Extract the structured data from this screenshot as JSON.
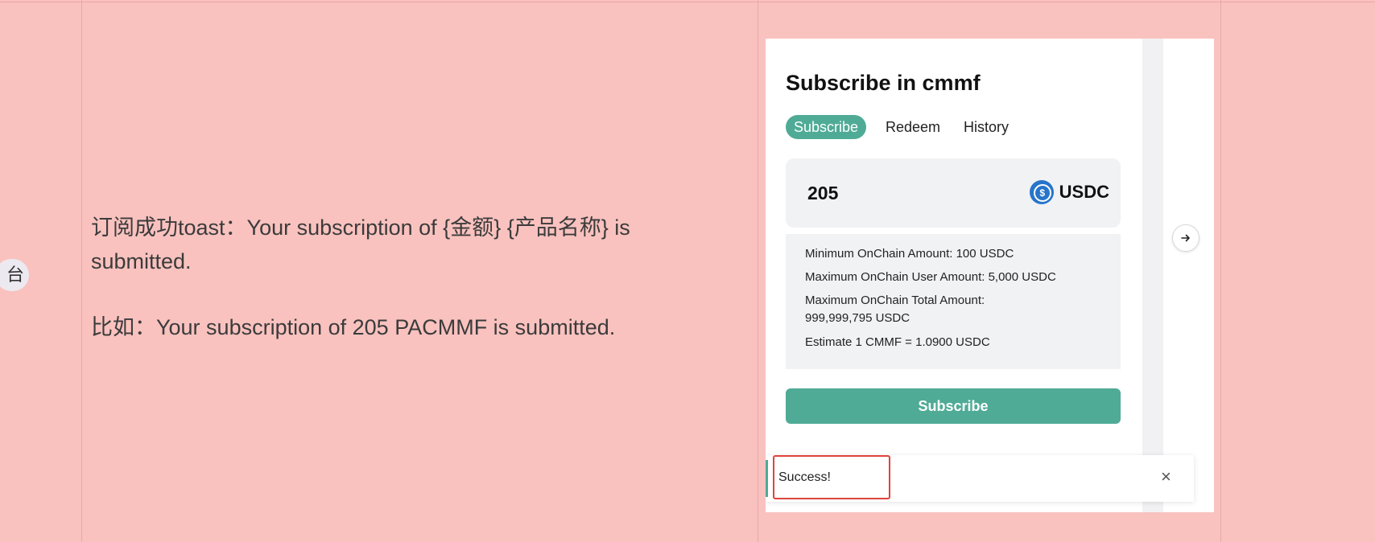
{
  "side_badge": {
    "text": "台"
  },
  "description": {
    "line1": "订阅成功toast：Your subscription of {金额} {产品名称} is submitted.",
    "line2": "比如：Your subscription of 205 PACMMF is submitted."
  },
  "widget": {
    "title": "Subscribe in cmmf",
    "tabs": [
      {
        "label": "Subscribe",
        "active": true
      },
      {
        "label": "Redeem",
        "active": false
      },
      {
        "label": "History",
        "active": false
      }
    ],
    "amount": {
      "value": "205",
      "token": "USDC",
      "token_icon": "usdc-coin-icon"
    },
    "info": [
      "Minimum OnChain Amount: 100 USDC",
      "Maximum OnChain User Amount: 5,000 USDC",
      "Maximum OnChain Total Amount:",
      "999,999,795 USDC",
      "Estimate 1 CMMF = 1.0900 USDC"
    ],
    "submit_label": "Subscribe",
    "next_icon": "arrow-right-icon",
    "accent_color": "#4fab96"
  },
  "toast": {
    "message": "Success!",
    "close_label": "×"
  },
  "colors": {
    "background": "#f9c2bf",
    "highlight": "#e0443b"
  }
}
